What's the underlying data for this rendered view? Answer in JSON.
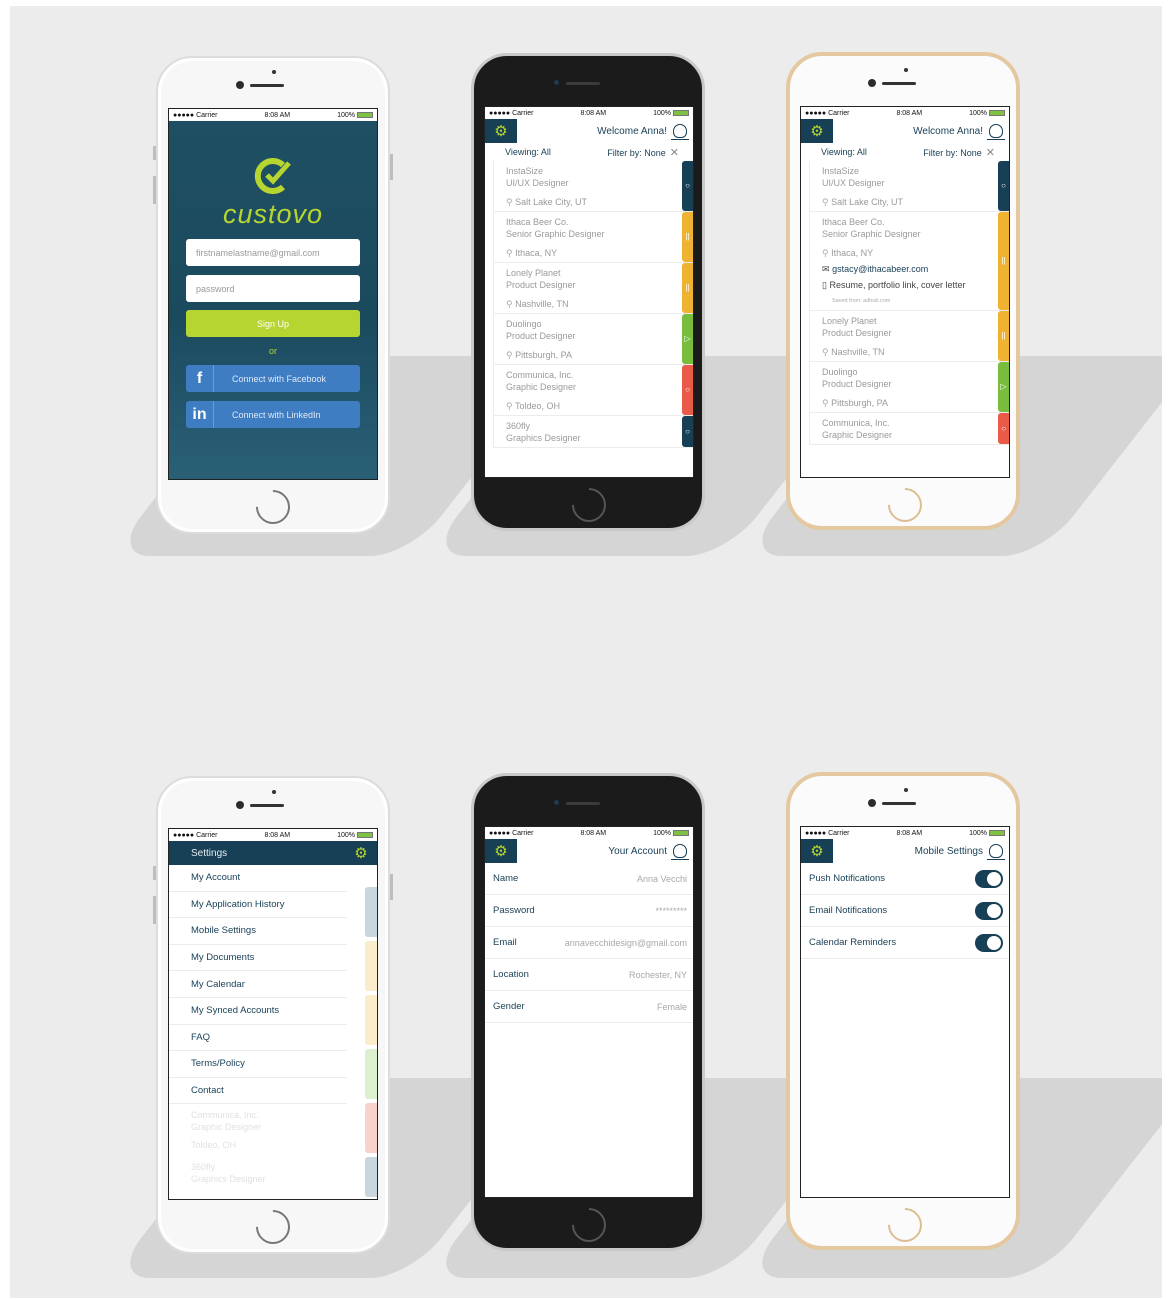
{
  "status_bar": {
    "carrier": "●●●●● Carrier",
    "time": "8:08 AM",
    "battery": "100%"
  },
  "login": {
    "logo_text": "custovo",
    "email_placeholder": "firstnamelastname@gmail.com",
    "password_placeholder": "password",
    "signup_label": "Sign Up",
    "or_label": "or",
    "facebook_label": "Connect with Facebook",
    "linkedin_label": "Connect with LinkedIn"
  },
  "list": {
    "welcome": "Welcome Anna!",
    "viewing": "Viewing: All",
    "filter": "Filter by: None"
  },
  "jobs_a": [
    {
      "company": "InstaSize",
      "role": "UI/UX Designer",
      "location": "Salt Lake City, UT",
      "status": "○",
      "color": "#173f55"
    },
    {
      "company": "Ithaca Beer Co.",
      "role": "Senior Graphic Designer",
      "location": "Ithaca, NY",
      "status": "||",
      "color": "#f0b331"
    },
    {
      "company": "Lonely Planet",
      "role": "Product Designer",
      "location": "Nashville, TN",
      "status": "||",
      "color": "#f0b331"
    },
    {
      "company": "Duolingo",
      "role": "Product Designer",
      "location": "Pittsburgh, PA",
      "status": "▷",
      "color": "#78bd3d"
    },
    {
      "company": "Communica, Inc.",
      "role": "Graphic Designer",
      "location": "Toldeo, OH",
      "status": "○",
      "color": "#ea5a48"
    },
    {
      "company": "360fly",
      "role": "Graphics Designer",
      "location": "",
      "status": "○",
      "color": "#173f55"
    }
  ],
  "jobs_b": [
    {
      "company": "InstaSize",
      "role": "UI/UX Designer",
      "location": "Salt Lake City, UT",
      "status": "○",
      "color": "#173f55"
    },
    {
      "company": "Ithaca Beer Co.",
      "role": "Senior Graphic Designer",
      "location": "Ithaca, NY",
      "status": "||",
      "color": "#f0b331",
      "email": "gstacy@ithacabeer.com",
      "docs": "Resume, portfolio link, cover letter",
      "saved": "Saved from: adhub.com"
    },
    {
      "company": "Lonely Planet",
      "role": "Product Designer",
      "location": "Nashville, TN",
      "status": "||",
      "color": "#f0b331"
    },
    {
      "company": "Duolingo",
      "role": "Product Designer",
      "location": "Pittsburgh, PA",
      "status": "▷",
      "color": "#78bd3d"
    },
    {
      "company": "Communica, Inc.",
      "role": "Graphic Designer",
      "location": "",
      "status": "○",
      "color": "#ea5a48"
    }
  ],
  "settings": {
    "title": "Settings",
    "items": [
      "My Account",
      "My Application History",
      "Mobile Settings",
      "My Documents",
      "My Calendar",
      "My Synced Accounts",
      "FAQ",
      "Terms/Policy",
      "Contact"
    ],
    "ghost_1a": "Communica, Inc.",
    "ghost_1b": "Graphic Designer",
    "ghost_1c": "Toldeo, OH",
    "ghost_2a": "360fly",
    "ghost_2b": "Graphics Designer"
  },
  "account": {
    "title": "Your Account",
    "rows": [
      {
        "k": "Name",
        "v": "Anna Vecchi"
      },
      {
        "k": "Password",
        "v": "*********"
      },
      {
        "k": "Email",
        "v": "annavecchidesign@gmail.com"
      },
      {
        "k": "Location",
        "v": "Rochester, NY"
      },
      {
        "k": "Gender",
        "v": "Female"
      }
    ]
  },
  "mobile_settings": {
    "title": "Mobile Settings",
    "rows": [
      {
        "k": "Push Notifications",
        "on": true
      },
      {
        "k": "Email Notifications",
        "on": true
      },
      {
        "k": "Calendar Reminders",
        "on": true
      }
    ]
  }
}
